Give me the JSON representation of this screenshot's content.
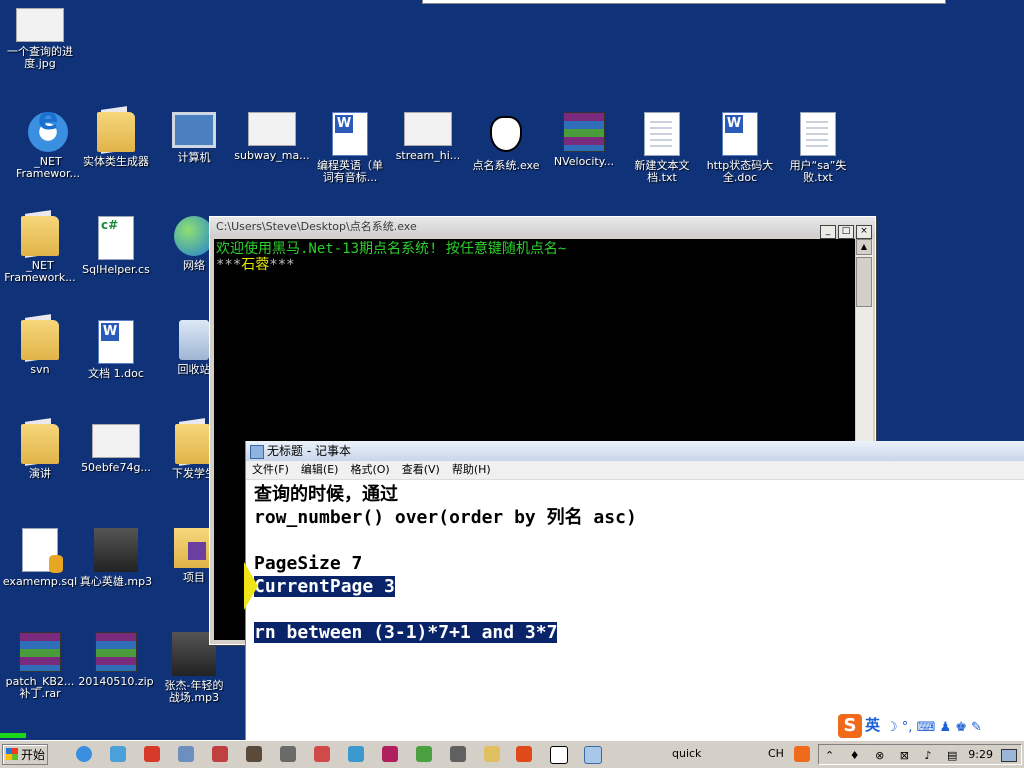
{
  "desktop": {
    "icons": [
      {
        "label": "一个查询的进\n度.jpg",
        "icon": "image-file-icon"
      },
      {
        "label": "_NET\nFramewor...",
        "icon": "ie-icon"
      },
      {
        "label": "实体类生成器",
        "icon": "folder-icon"
      },
      {
        "label": "计算机",
        "icon": "computer-icon"
      },
      {
        "label": "subway_ma...",
        "icon": "image-file-icon"
      },
      {
        "label": "编程英语（单\n词有音标...",
        "icon": "word-doc-icon"
      },
      {
        "label": "stream_hi...",
        "icon": "image-file-icon"
      },
      {
        "label": "点名系统.exe",
        "icon": "fox-app-icon"
      },
      {
        "label": "NVelocity...",
        "icon": "rar-archive-icon"
      },
      {
        "label": "新建文本文\n档.txt",
        "icon": "text-file-icon"
      },
      {
        "label": "http状态码大\n全.doc",
        "icon": "word-doc-icon"
      },
      {
        "label": "用户“sa”失\n败.txt",
        "icon": "text-file-icon"
      },
      {
        "label": "_NET\nFramework...",
        "icon": "folder-icon"
      },
      {
        "label": "SqlHelper.cs",
        "icon": "csharp-file-icon"
      },
      {
        "label": "网络",
        "icon": "network-icon"
      },
      {
        "label": "svn",
        "icon": "folder-icon"
      },
      {
        "label": "文档 1.doc",
        "icon": "word-doc-icon"
      },
      {
        "label": "回收站",
        "icon": "recycle-bin-icon"
      },
      {
        "label": "演讲",
        "icon": "folder-icon"
      },
      {
        "label": "50ebfe74g...",
        "icon": "image-file-icon"
      },
      {
        "label": "下发学生",
        "icon": "folder-icon"
      },
      {
        "label": "examemp.sql",
        "icon": "sql-file-icon"
      },
      {
        "label": "真心英雄.mp3",
        "icon": "mp3-file-icon"
      },
      {
        "label": "项目",
        "icon": "vs-folder-icon"
      },
      {
        "label": "patch_KB2...\n补丁.rar",
        "icon": "rar-archive-icon"
      },
      {
        "label": "20140510.zip",
        "icon": "rar-archive-icon"
      },
      {
        "label": "张杰-年轻的\n战场.mp3",
        "icon": "mp3-file-icon"
      }
    ]
  },
  "console": {
    "title": "C:\\Users\\Steve\\Desktop\\点名系统.exe",
    "line1": "欢迎使用黑马.Net-13期点名系统! 按任意键随机点名~",
    "line2_prefix": "***",
    "line2_name": "石蓉",
    "line2_suffix": "***",
    "buttons": [
      "_",
      "□",
      "×"
    ]
  },
  "notepad": {
    "title": "无标题 - 记事本",
    "menu": [
      "文件(F)",
      "编辑(E)",
      "格式(O)",
      "查看(V)",
      "帮助(H)"
    ],
    "lines": [
      {
        "text": "查询的时候，通过",
        "selected": false
      },
      {
        "text": "row_number() over(order by 列名 asc)",
        "selected": false
      },
      {
        "text": "",
        "selected": false
      },
      {
        "text": "PageSize 7",
        "selected": false
      },
      {
        "text": "CurrentPage 3",
        "selected": true
      },
      {
        "text": "",
        "selected": false
      },
      {
        "text": "rn between (3-1)*7+1 and 3*7",
        "selected": true
      }
    ]
  },
  "ime": {
    "logo": "S",
    "mode": "英",
    "tools": "☽ °, ⌨ ♟ ♚ ✎"
  },
  "taskbar": {
    "start_label": "开始",
    "quick_label": "quick",
    "lang": "CH",
    "clock": "9:29"
  }
}
